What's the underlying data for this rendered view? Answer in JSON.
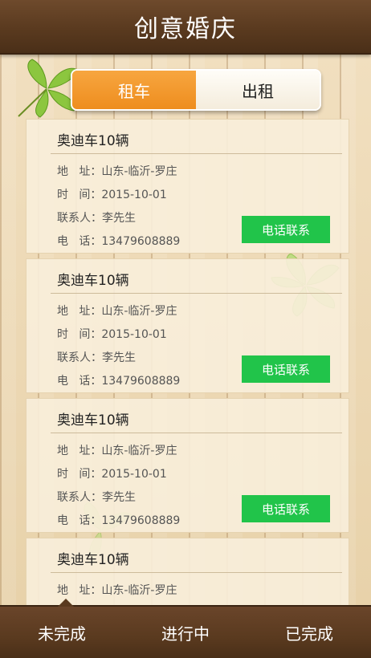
{
  "header": {
    "title": "创意婚庆"
  },
  "tabs": [
    {
      "label": "租车",
      "active": true
    },
    {
      "label": "出租",
      "active": false
    }
  ],
  "labels": {
    "address": "地   址：",
    "time": "时   间：",
    "contact": "联系人：",
    "phone": "电   话："
  },
  "cards": [
    {
      "title": "奥迪车10辆",
      "address": "山东-临沂-罗庄",
      "time": "2015-10-01",
      "contact": "李先生",
      "phone": "13479608889",
      "button": "电话联系"
    },
    {
      "title": "奥迪车10辆",
      "address": "山东-临沂-罗庄",
      "time": "2015-10-01",
      "contact": "李先生",
      "phone": "13479608889",
      "button": "电话联系"
    },
    {
      "title": "奥迪车10辆",
      "address": "山东-临沂-罗庄",
      "time": "2015-10-01",
      "contact": "李先生",
      "phone": "13479608889",
      "button": "电话联系"
    },
    {
      "title": "奥迪车10辆",
      "address": "山东-临沂-罗庄",
      "time": "",
      "contact": "",
      "phone": "",
      "button": ""
    }
  ],
  "bottom_nav": [
    {
      "label": "未完成"
    },
    {
      "label": "进行中"
    },
    {
      "label": "已完成"
    }
  ],
  "colors": {
    "accent": "#ee8d1e",
    "button": "#21c44a",
    "header": "#5a3a1f"
  }
}
